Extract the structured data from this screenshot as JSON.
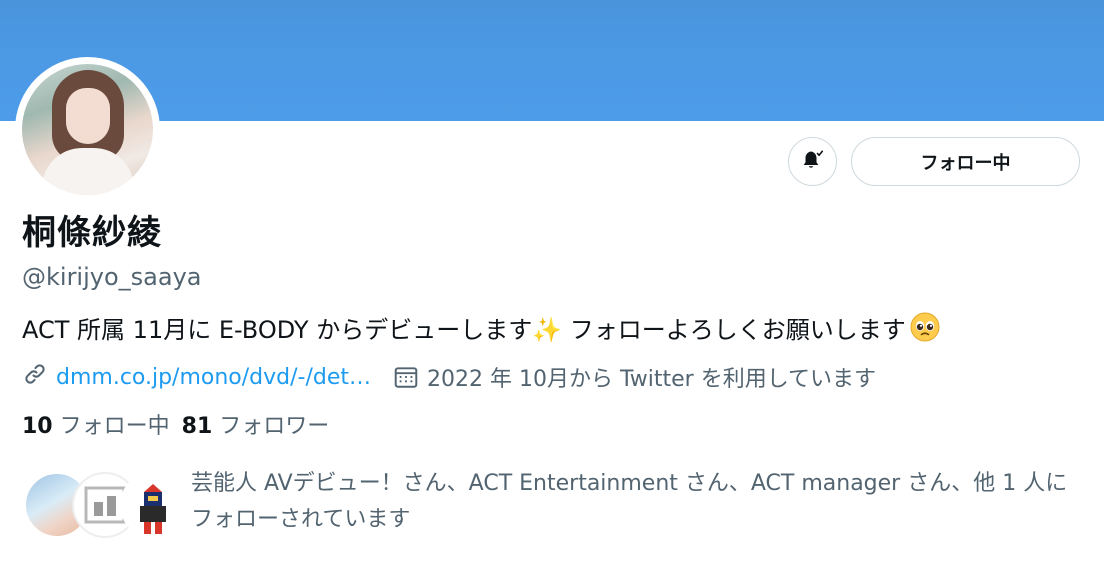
{
  "profile": {
    "name": "桐條紗綾",
    "handle": "@kirijyo_saaya",
    "bio": "ACT 所属 11月に E-BODY からデビューします✨ フォローよろしくお願いします",
    "link": "dmm.co.jp/mono/dvd/-/det…",
    "joined": "2022 年 10月から Twitter を利用しています"
  },
  "actions": {
    "follow_label": "フォロー中"
  },
  "stats": {
    "following_count": "10",
    "following_label": "フォロー中",
    "followers_count": "81",
    "followers_label": "フォロワー"
  },
  "followed_by": {
    "text": "芸能人 AVデビュー！さん、ACT Entertainment さん、ACT manager さん、他 1 人にフォローされています"
  },
  "colors": {
    "banner": "#4d9ce9",
    "link": "#1d9bf0",
    "secondary_text": "#536471",
    "border": "#cfd9de"
  },
  "icons": {
    "bell": "bell-check-icon",
    "link": "link-icon",
    "calendar": "calendar-icon",
    "emoji": "pleading-face-icon"
  }
}
